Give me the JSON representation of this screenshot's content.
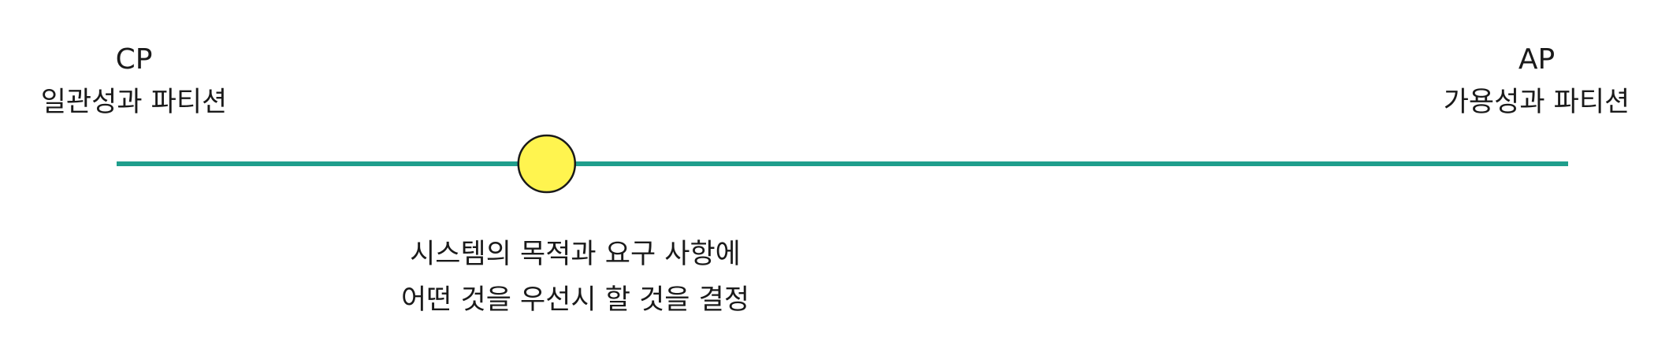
{
  "left_end": {
    "abbr": "CP",
    "label": "일관성과 파티션"
  },
  "right_end": {
    "abbr": "AP",
    "label": "가용성과 파티션"
  },
  "slider": {
    "position_fraction": 0.2963
  },
  "caption": {
    "line1": "시스템의 목적과 요구 사항에",
    "line2": "어떤 것을 우선시 할 것을 결정"
  },
  "colors": {
    "line": "#1f9e8c",
    "marker_fill": "#fff44f",
    "marker_stroke": "#1a1a1a",
    "text": "#1a1a1a"
  }
}
